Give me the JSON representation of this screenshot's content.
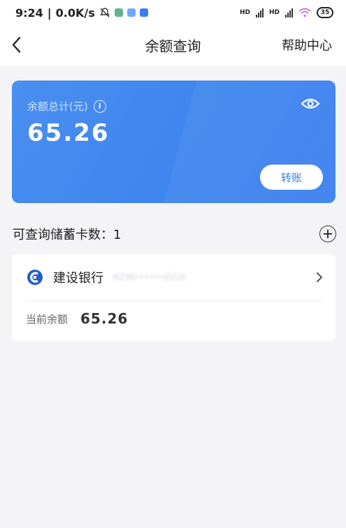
{
  "status_bar": {
    "time": "9:24",
    "speed": "0.0K/s",
    "hd1": "HD",
    "hd2": "HD",
    "battery": "35"
  },
  "header": {
    "title": "余额查询",
    "help": "帮助中心"
  },
  "summary": {
    "label": "余额总计(元)",
    "amount": "65.26",
    "transfer_label": "转账"
  },
  "cards": {
    "count_text": "可查询储蓄卡数：1"
  },
  "bank": {
    "name": "建设银行",
    "card_no": "6236••••••0216",
    "balance_label": "当前余额",
    "balance": "65.26"
  },
  "colors": {
    "card_blue": "#4387ef",
    "accent": "#3b7fe8",
    "background": "#f4f4f6"
  }
}
